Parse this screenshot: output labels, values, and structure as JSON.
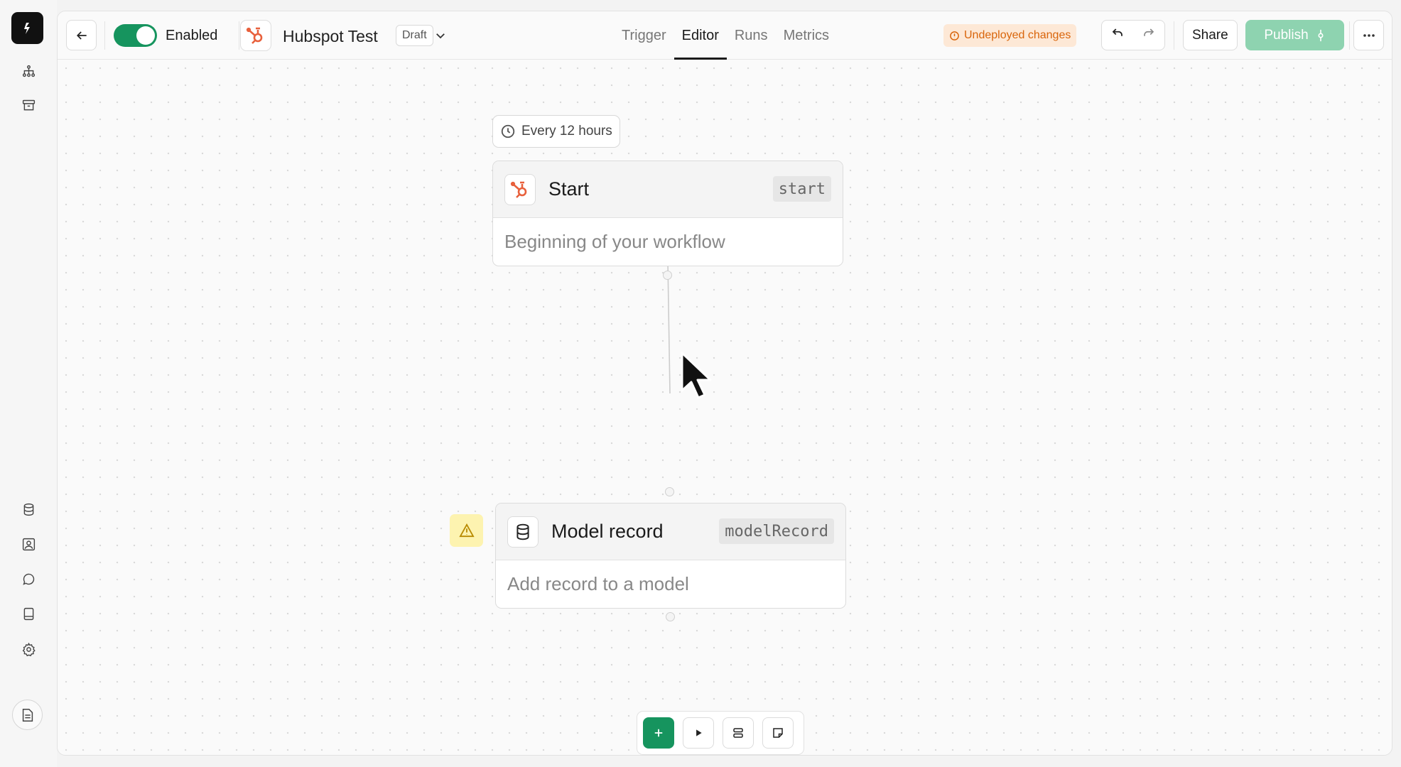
{
  "toolbar": {
    "enabled_label": "Enabled",
    "workflow_title": "Hubspot Test",
    "status_badge": "Draft",
    "tabs": [
      {
        "label": "Trigger",
        "active": false
      },
      {
        "label": "Editor",
        "active": true
      },
      {
        "label": "Runs",
        "active": false
      },
      {
        "label": "Metrics",
        "active": false
      }
    ],
    "undeployed_label": "Undeployed changes",
    "share_label": "Share",
    "publish_label": "Publish"
  },
  "canvas": {
    "schedule_label": "Every 12 hours",
    "nodes": [
      {
        "title": "Start",
        "key": "start",
        "description": "Beginning of your workflow",
        "icon": "hubspot-icon"
      },
      {
        "title": "Model record",
        "key": "modelRecord",
        "description": "Add record to a model",
        "icon": "database-icon"
      }
    ]
  },
  "colors": {
    "accent_green": "#16945e",
    "publish_disabled": "#8ed3b0",
    "hubspot_orange": "#e8603c",
    "warning_orange": "#d9650b",
    "warning_bg": "#fde8d6",
    "warn_badge_bg": "#fdf3b0"
  },
  "icons": [
    "app-logo-icon",
    "workflow-tree-icon",
    "archive-icon",
    "database-icon",
    "contact-icon",
    "chat-icon",
    "book-icon",
    "gear-icon",
    "docs-icon",
    "back-arrow-icon",
    "hubspot-icon",
    "chevron-down-icon",
    "clock-icon",
    "warning-icon",
    "undo-icon",
    "redo-icon",
    "more-icon",
    "plus-icon",
    "play-icon",
    "list-icon",
    "note-icon"
  ]
}
